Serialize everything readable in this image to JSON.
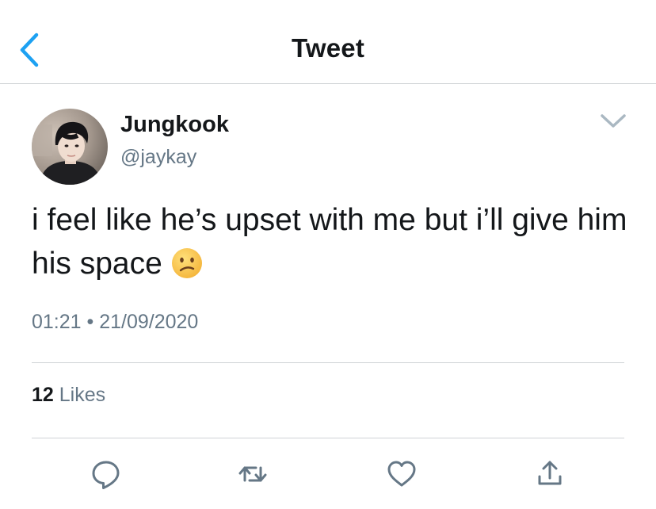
{
  "header": {
    "title": "Tweet",
    "back_icon": "chevron-left-icon"
  },
  "tweet": {
    "author": {
      "display_name": "Jungkook",
      "handle": "@jaykay"
    },
    "text": "i feel like he’s upset with me but i’ll give him his space",
    "emoji": "confused-face",
    "timestamp": "01:21 • 21/09/2020",
    "likes_count": "12",
    "likes_label": "Likes"
  },
  "actions": {
    "icons": [
      "reply-icon",
      "retweet-icon",
      "like-icon",
      "share-icon"
    ]
  },
  "colors": {
    "accent": "#1da1f2",
    "text": "#14171a",
    "secondary": "#657786",
    "divider": "#cfd3d6",
    "icon": "#657786"
  }
}
